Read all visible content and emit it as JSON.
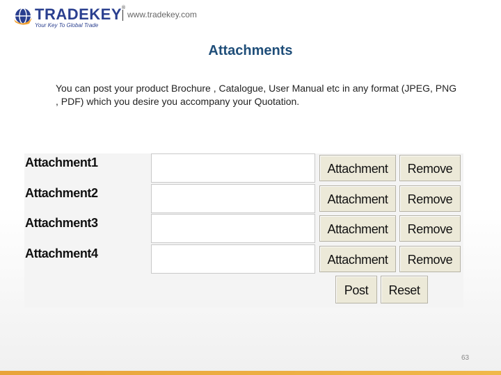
{
  "header": {
    "brand": "TRADEKEY",
    "trademark": "®",
    "tagline": "Your Key To Global Trade",
    "url": "www.tradekey.com"
  },
  "slide": {
    "title": "Attachments",
    "description": "You can post your product Brochure , Catalogue, User Manual etc in any format (JPEG, PNG , PDF) which you desire you accompany your Quotation.",
    "page_number": "63"
  },
  "form": {
    "rows": [
      {
        "label": "Attachment1",
        "value": "",
        "attach_label": "Attachment",
        "remove_label": "Remove"
      },
      {
        "label": "Attachment2",
        "value": "",
        "attach_label": "Attachment",
        "remove_label": "Remove"
      },
      {
        "label": "Attachment3",
        "value": "",
        "attach_label": "Attachment",
        "remove_label": "Remove"
      },
      {
        "label": "Attachment4",
        "value": "",
        "attach_label": "Attachment",
        "remove_label": "Remove"
      }
    ],
    "post_label": "Post",
    "reset_label": "Reset"
  },
  "colors": {
    "brand_blue": "#2a3f8f",
    "brand_orange": "#f0a030",
    "title_blue": "#1f4e79",
    "button_face": "#ece9d8"
  }
}
